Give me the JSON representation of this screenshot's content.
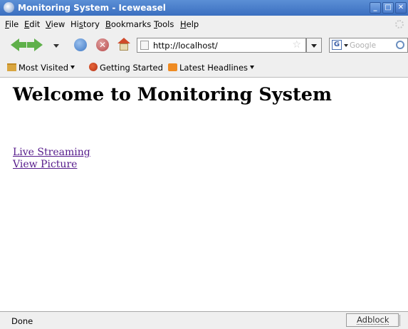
{
  "window": {
    "title": "Monitoring System - Iceweasel",
    "controls": {
      "minimize": "_",
      "maximize": "□",
      "close": "✕"
    }
  },
  "menu": {
    "items": [
      {
        "text": "File",
        "mnemonic": "F",
        "rest": "ile"
      },
      {
        "text": "Edit",
        "mnemonic": "E",
        "rest": "dit"
      },
      {
        "text": "View",
        "mnemonic": "V",
        "rest": "iew"
      },
      {
        "text": "History",
        "pre": "Hi",
        "mnemonic": "s",
        "rest": "tory"
      },
      {
        "text": "Bookmarks",
        "mnemonic": "B",
        "rest": "ookmarks"
      },
      {
        "text": "Tools",
        "mnemonic": "T",
        "rest": "ools"
      },
      {
        "text": "Help",
        "mnemonic": "H",
        "rest": "elp"
      }
    ]
  },
  "navigation": {
    "url": "http://localhost/",
    "search_placeholder": "Google",
    "search_engine_glyph": "G",
    "stop_glyph": "✕",
    "star_glyph": "☆",
    "icons": [
      "back-arrow-icon",
      "forward-arrow-icon",
      "history-dropdown-icon",
      "reload-icon",
      "stop-icon",
      "home-icon",
      "site-identity-icon",
      "bookmark-star-icon",
      "google-icon",
      "search-icon"
    ]
  },
  "bookmarks": {
    "items": [
      {
        "label": "Most Visited",
        "icon": "folder-icon",
        "dropdown": true
      },
      {
        "label": "Getting Started",
        "icon": "firefox-icon",
        "dropdown": false
      },
      {
        "label": "Latest Headlines",
        "icon": "rss-icon",
        "dropdown": true
      }
    ]
  },
  "page": {
    "heading": "Welcome to Monitoring System",
    "links": [
      {
        "label": "Live Streaming"
      },
      {
        "label": "View Picture"
      }
    ],
    "link_color": "#551a8b"
  },
  "status": {
    "text": "Done",
    "adblock": "Adblock"
  },
  "colors": {
    "titlebar": "#3b6fc0",
    "chrome": "#efefef",
    "nav_arrows": "#5fb04a"
  }
}
